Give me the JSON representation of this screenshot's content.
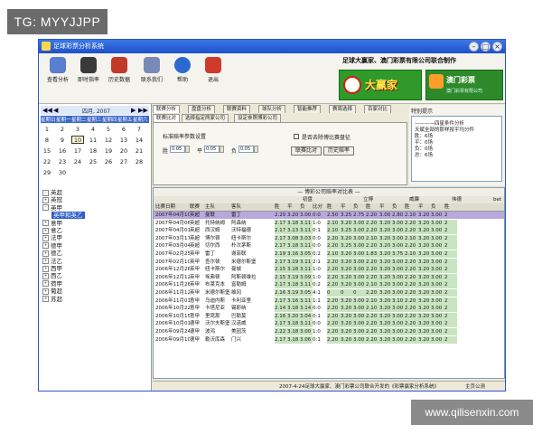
{
  "watermark_top": "TG: MYYJJPP",
  "watermark_bottom": "www.qilisenxin.com",
  "window": {
    "title": "足球彩票分析系统",
    "controls": [
      "–",
      "□",
      "×"
    ]
  },
  "toolbar": {
    "buttons": [
      {
        "label": "查看分析",
        "icon": "view-analysis-icon",
        "color": "#5a7fd0"
      },
      {
        "label": "即时指率",
        "icon": "live-odds-icon",
        "color": "#3a3a3a"
      },
      {
        "label": "历史数据",
        "icon": "history-data-icon",
        "color": "#c23a2a"
      },
      {
        "label": "联系我们",
        "icon": "contact-icon",
        "color": "#7a8ab8"
      },
      {
        "label": "帮助",
        "icon": "help-icon",
        "color": "#2a6ad0"
      },
      {
        "label": "退出",
        "icon": "exit-icon",
        "color": "#d03a2a"
      }
    ],
    "brand_text": "足球大赢家、澳门彩票有限公司联合制作",
    "ad1_text": "大赢家",
    "ad2_text": "澳门彩票",
    "ad2_sub": "澳门彩票有限公司"
  },
  "calendar": {
    "month": "四月, 2007",
    "nav": [
      "◀◀",
      "◀",
      "▶",
      "▶▶"
    ],
    "weekdays": [
      "星期日",
      "星期一",
      "星期二",
      "星期三",
      "星期四",
      "星期五",
      "星期六"
    ],
    "weeks": [
      [
        "1",
        "2",
        "3",
        "4",
        "5",
        "6",
        "7"
      ],
      [
        "8",
        "9",
        "10",
        "11",
        "12",
        "13",
        "14"
      ],
      [
        "15",
        "16",
        "17",
        "18",
        "19",
        "20",
        "21"
      ],
      [
        "22",
        "23",
        "24",
        "25",
        "26",
        "27",
        "28"
      ],
      [
        "29",
        "30",
        "",
        "",
        "",
        "",
        ""
      ]
    ],
    "selected": "10"
  },
  "tree": [
    {
      "label": "英超",
      "expanded": true,
      "level": 0
    },
    {
      "label": "英冠",
      "expanded": false,
      "level": 0
    },
    {
      "label": "英甲",
      "expanded": true,
      "level": 0
    },
    {
      "label": "英甲和英乙",
      "expanded": false,
      "level": 1,
      "highlight": true
    },
    {
      "label": "意甲",
      "expanded": false,
      "level": 0
    },
    {
      "label": "意乙",
      "expanded": false,
      "level": 0
    },
    {
      "label": "法甲",
      "expanded": false,
      "level": 0
    },
    {
      "label": "德甲",
      "expanded": false,
      "level": 0
    },
    {
      "label": "德乙",
      "expanded": false,
      "level": 0
    },
    {
      "label": "法乙",
      "expanded": false,
      "level": 0
    },
    {
      "label": "西甲",
      "expanded": false,
      "level": 0
    },
    {
      "label": "西乙",
      "expanded": false,
      "level": 0
    },
    {
      "label": "荷甲",
      "expanded": false,
      "level": 0
    },
    {
      "label": "葡超",
      "expanded": false,
      "level": 0
    },
    {
      "label": "苏超",
      "expanded": false,
      "level": 0
    }
  ],
  "tabs_top": [
    "联赛分析",
    "盘盘分析",
    "联赛资料",
    "球队分析",
    "智能推荐",
    "赛周选择",
    "百家对比"
  ],
  "tabs_second": [
    "联赛比对",
    "选择指定两家公司",
    "设定参照博彩公司"
  ],
  "settings": {
    "title": "标准赔率参数设置",
    "win_label": "胜",
    "draw_label": "平",
    "loss_label": "负",
    "win_value": "0.05",
    "draw_value": "0.05",
    "loss_value": "0.05",
    "checkbox_label": "是否去除博比赛盘征",
    "btn_compare": "联赛比对",
    "btn_history": "历史赔率"
  },
  "right_info": {
    "header": "特别提示",
    "lines": [
      "————四星条件分析",
      "天赋全部的那样按平均分件",
      "胜：6场",
      "平：0场",
      "负：0场",
      "总：6场"
    ]
  },
  "table": {
    "caption": "— 博彩公司赔率对比表 —",
    "groups": [
      "初盘",
      "立博",
      "威廉",
      "伟德",
      "bet"
    ],
    "headers": [
      "比赛日期",
      "联赛",
      "主队",
      "客队",
      "胜",
      "平",
      "负",
      "比分",
      "胜",
      "平",
      "负",
      "胜",
      "平",
      "负",
      "胜",
      "平",
      "负",
      "胜"
    ],
    "rows": [
      [
        "2007年04月10日",
        "英超",
        "曼联",
        "雷丁",
        "2.20",
        "3.20",
        "3.00",
        "0:0",
        "2.50",
        "3.25",
        "2.75",
        "2.20",
        "3.00",
        "2.80",
        "2.10",
        "3.20",
        "3.00",
        "2"
      ],
      [
        "2007年04月06日",
        "英超",
        "托特纳姆",
        "阿森纳",
        "2.17",
        "3.18",
        "3.11",
        "1:0",
        "2.10",
        "3.20",
        "3.00",
        "2.20",
        "3.20",
        "3.00",
        "2.20",
        "3.20",
        "3.00",
        "2"
      ],
      [
        "2007年04月01日",
        "英超",
        "西汉姆",
        "沃特福德",
        "2.17",
        "3.13",
        "3.11",
        "0:1",
        "2.10",
        "3.25",
        "3.00",
        "2.20",
        "3.20",
        "3.00",
        "2.20",
        "3.20",
        "3.00",
        "2"
      ],
      [
        "2007年03月17日",
        "英超",
        "博尔顿",
        "纽卡斯尔",
        "2.17",
        "3.08",
        "3.03",
        "0:0",
        "2.20",
        "3.20",
        "3.00",
        "2.10",
        "3.20",
        "3.00",
        "2.10",
        "3.20",
        "3.00",
        "2"
      ],
      [
        "2007年03月04日",
        "英超",
        "切尔西",
        "朴次茅斯",
        "2.17",
        "3.18",
        "3.11",
        "0:0",
        "2.20",
        "3.25",
        "3.00",
        "2.20",
        "3.20",
        "3.00",
        "2.20",
        "3.20",
        "3.00",
        "2"
      ],
      [
        "2007年02月25日",
        "英甲",
        "雷丁",
        "谢菲联",
        "2.19",
        "3.16",
        "3.05",
        "0:2",
        "2.10",
        "3.20",
        "3.00",
        "1.83",
        "3.20",
        "3.75",
        "2.10",
        "3.20",
        "3.00",
        "2"
      ],
      [
        "2007年02月10日",
        "英甲",
        "查尔顿",
        "米德尔斯堡",
        "2.17",
        "3.19",
        "3.11",
        "2:1",
        "2.20",
        "3.20",
        "3.00",
        "2.20",
        "3.20",
        "3.00",
        "2.20",
        "3.20",
        "3.00",
        "2"
      ],
      [
        "2006年12月26日",
        "英甲",
        "纽卡斯尔",
        "曼城",
        "2.15",
        "3.18",
        "3.11",
        "1:0",
        "2.20",
        "3.20",
        "3.00",
        "2.20",
        "3.20",
        "3.00",
        "2.20",
        "3.20",
        "3.00",
        "2"
      ],
      [
        "2006年12月12日",
        "英甲",
        "埃弗顿",
        "阿斯顿维拉",
        "2.15",
        "3.19",
        "3.09",
        "1:0",
        "2.20",
        "3.20",
        "3.00",
        "2.20",
        "3.20",
        "3.00",
        "2.20",
        "3.20",
        "3.00",
        "2"
      ],
      [
        "2006年11月26日",
        "英甲",
        "布莱克本",
        "富勒姆",
        "2.17",
        "3.18",
        "3.11",
        "0:2",
        "2.20",
        "3.20",
        "3.00",
        "2.10",
        "3.20",
        "3.00",
        "2.20",
        "3.20",
        "3.00",
        "2"
      ],
      [
        "2006年11月12日",
        "英甲",
        "米德尔斯堡",
        "维冈",
        "2.16",
        "3.19",
        "3.05",
        "4:1",
        "0",
        "0",
        "0",
        "2.20",
        "3.20",
        "3.00",
        "2.20",
        "3.20",
        "3.00",
        "2"
      ],
      [
        "2006年11月01日",
        "意甲",
        "乌迪内斯",
        "卡利亚里",
        "2.17",
        "3.16",
        "3.11",
        "1:1",
        "2.20",
        "3.20",
        "3.00",
        "2.10",
        "3.20",
        "3.10",
        "2.20",
        "3.20",
        "3.00",
        "2"
      ],
      [
        "2006年10月22日",
        "意甲",
        "卡塔尼亚",
        "锡耶纳",
        "2.14",
        "3.18",
        "3.14",
        "0:0",
        "2.20",
        "3.20",
        "3.00",
        "2.10",
        "3.20",
        "3.00",
        "2.20",
        "3.20",
        "3.00",
        "2"
      ],
      [
        "2006年10月15日",
        "意甲",
        "里窝那",
        "巴勒莫",
        "2.16",
        "3.20",
        "3.04",
        "0:1",
        "2.20",
        "3.20",
        "3.00",
        "2.20",
        "3.20",
        "3.00",
        "2.20",
        "3.20",
        "3.00",
        "2"
      ],
      [
        "2006年10月01日",
        "德甲",
        "沃尔夫斯堡",
        "汉诺威",
        "2.17",
        "3.18",
        "3.11",
        "0:0",
        "2.20",
        "3.20",
        "3.00",
        "2.20",
        "3.20",
        "3.00",
        "2.20",
        "3.20",
        "3.00",
        "2"
      ],
      [
        "2006年09月24日",
        "德甲",
        "波鸿",
        "美因茨",
        "2.22",
        "3.18",
        "3.00",
        "1:0",
        "2.20",
        "3.20",
        "3.00",
        "2.20",
        "3.20",
        "3.00",
        "2.20",
        "3.20",
        "3.00",
        "2"
      ],
      [
        "2006年09月10日",
        "德甲",
        "勒沃库森",
        "门兴",
        "2.17",
        "3.18",
        "3.06",
        "0:1",
        "2.20",
        "3.20",
        "3.00",
        "2.20",
        "3.20",
        "3.00",
        "2.20",
        "3.20",
        "3.00",
        "2"
      ]
    ],
    "selected_row": 0
  },
  "statusbar": {
    "text": "2007-4-24足球大赢家、澳门彩票公司联合开发的《彩票赢家分析系统》",
    "right": "主页公测"
  },
  "colors": {
    "titlebar": "#2a5fd6",
    "highlight_column": "#c8e4c0",
    "selected_row": "#b8a8dc"
  }
}
